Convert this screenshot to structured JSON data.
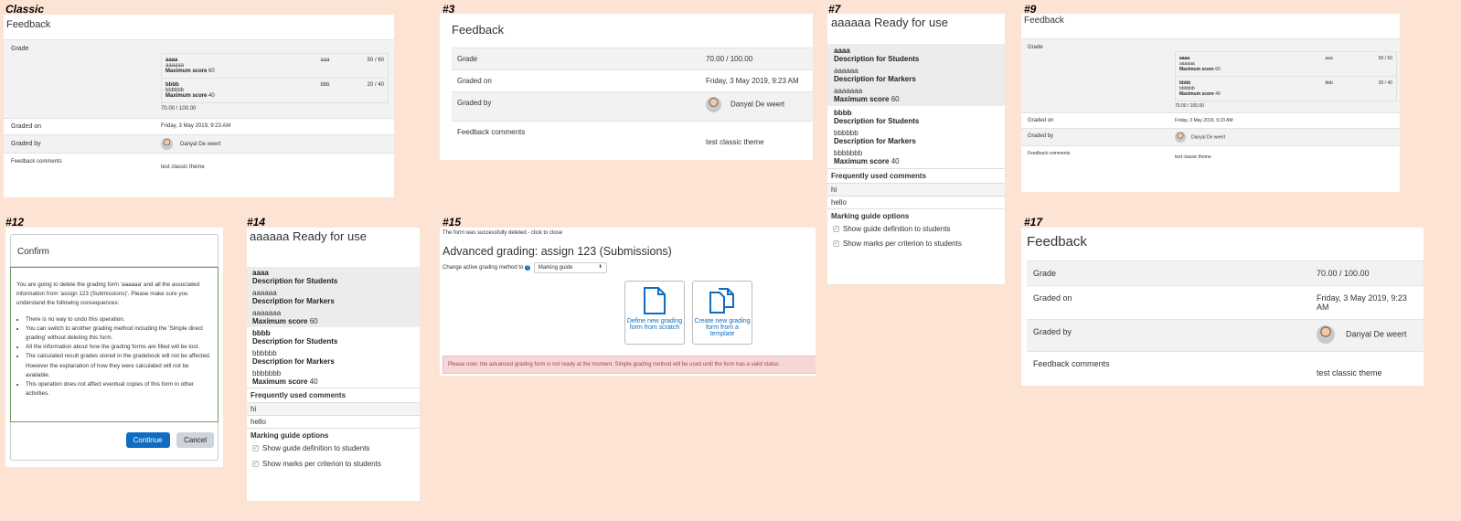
{
  "labels": {
    "classic": "Classic",
    "p3": "#3",
    "p7": "#7",
    "p9": "#9",
    "p12": "#12",
    "p14": "#14",
    "p15": "#15",
    "p17": "#17"
  },
  "feedback": {
    "title": "Feedback",
    "grade_label": "Grade",
    "grade_value": "70.00 / 100.00",
    "graded_on_label": "Graded on",
    "graded_on_value": "Friday, 3 May 2019, 9:23 AM",
    "graded_by_label": "Graded by",
    "grader_name": "Danyal De weert",
    "comments_label": "Feedback comments",
    "comments_value": "test classic theme"
  },
  "rubric": {
    "max_score_label": "Maximum score",
    "criteria": [
      {
        "name": "aaaa",
        "desc": "aaaaaa",
        "remark": "aaa",
        "score": "50 / 60",
        "max": "60"
      },
      {
        "name": "bbbb",
        "desc": "bbbbbb",
        "remark": "bbb",
        "score": "20 / 40",
        "max": "40"
      }
    ]
  },
  "guide": {
    "title": "aaaaaa Ready for use",
    "desc_students_label": "Description for Students",
    "desc_markers_label": "Description for Markers",
    "max_score_label": "Maximum score",
    "criteria": [
      {
        "name": "aaaa",
        "students": "aaaaaa",
        "markers": "aaaaaaa",
        "max": "60"
      },
      {
        "name": "bbbb",
        "students": "bbbbbb",
        "markers": "bbbbbbb",
        "max": "40"
      }
    ],
    "freq_comments_label": "Frequently used comments",
    "comments": [
      "hi",
      "hello"
    ],
    "options_label": "Marking guide options",
    "opt1": "Show guide definition to students",
    "opt2": "Show marks per criterion to students"
  },
  "confirm": {
    "title": "Confirm",
    "message": "You are going to delete the grading form 'aaaaaa' and all the associated information from 'assign 123 (Submissions)'. Please make sure you understand the following consequences:",
    "items": [
      "There is no way to undo this operation.",
      "You can switch to another grading method including the 'Simple direct grading' without deleting this form.",
      "All the information about how the grading forms are filled will be lost.",
      "The calculated result grades stored in the gradebook will not be affected. However the explanation of how they were calculated will not be available.",
      "This operation does not affect eventual copies of this form in other activities."
    ],
    "continue": "Continue",
    "cancel": "Cancel"
  },
  "advanced": {
    "notice": "The form was successfully deleted - click to close",
    "title": "Advanced grading: assign 123 (Submissions)",
    "method_label": "Change active grading method to",
    "method_value": "Marking guide",
    "btn_new": "Define new grading form from scratch",
    "btn_template": "Create new grading form from a template",
    "warning": "Please note: the advanced grading form is not ready at the moment. Simple grading method will be used until the form has a valid status.",
    "colors": {
      "warning_bg": "#f6d7d7",
      "warning_text": "#a94442",
      "link": "#0f6cbf"
    }
  }
}
